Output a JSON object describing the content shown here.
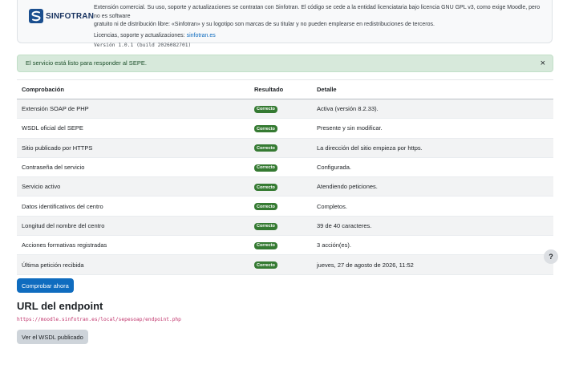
{
  "plugin_info": {
    "logo_text": "SINFOTRAN",
    "description_lines": [
      "Extensión comercial. Su uso, soporte y actualizaciones se contratan con Sinfotran. El código se cede a la entidad licenciataria bajo licencia GNU GPL v3, como exige Moodle, pero no es software",
      "gratuito ni de distribución libre: «Sinfotran» y su logotipo son marcas de su titular y no pueden emplearse en redistribuciones de terceros."
    ],
    "license_prefix": "Licencias, soporte y actualizaciones: ",
    "license_link": "sinfotran.es",
    "version": "Versión 1.0.1 (build 2026082701)"
  },
  "alert": {
    "message": "El servicio está listo para responder al SEPE.",
    "close_glyph": "×"
  },
  "checks_table": {
    "headers": [
      "Comprobación",
      "Resultado",
      "Detalle"
    ],
    "rows": [
      {
        "check": "Extensión SOAP de PHP",
        "result": "Correcto",
        "detail": "Activa (versión 8.2.33)."
      },
      {
        "check": "WSDL oficial del SEPE",
        "result": "Correcto",
        "detail": "Presente y sin modificar."
      },
      {
        "check": "Sitio publicado por HTTPS",
        "result": "Correcto",
        "detail": "La dirección del sitio empieza por https."
      },
      {
        "check": "Contraseña del servicio",
        "result": "Correcto",
        "detail": "Configurada."
      },
      {
        "check": "Servicio activo",
        "result": "Correcto",
        "detail": "Atendiendo peticiones."
      },
      {
        "check": "Datos identificativos del centro",
        "result": "Correcto",
        "detail": "Completos."
      },
      {
        "check": "Longitud del nombre del centro",
        "result": "Correcto",
        "detail": "39 de 40 caracteres."
      },
      {
        "check": "Acciones formativas registradas",
        "result": "Correcto",
        "detail": "3 acción(es)."
      },
      {
        "check": "Última petición recibida",
        "result": "Correcto",
        "detail": "jueves, 27 de agosto de 2026, 11:52"
      }
    ]
  },
  "help_button": {
    "glyph": "?"
  },
  "check_now_button": {
    "label": "Comprobar ahora"
  },
  "endpoint": {
    "title": "URL del endpoint",
    "url": "https://moodle.sinfotran.es/local/sepesoap/endpoint.php",
    "wsdl_button_label": "Ver el WSDL publicado"
  },
  "colors": {
    "primary": "#0f6cbf",
    "success_badge": "#357a32",
    "alert_bg": "#d7e9db",
    "url_text": "#c0336b"
  },
  "icons": {
    "logo": "sinfotran-logo-icon",
    "close": "close-icon",
    "help": "help-icon"
  }
}
